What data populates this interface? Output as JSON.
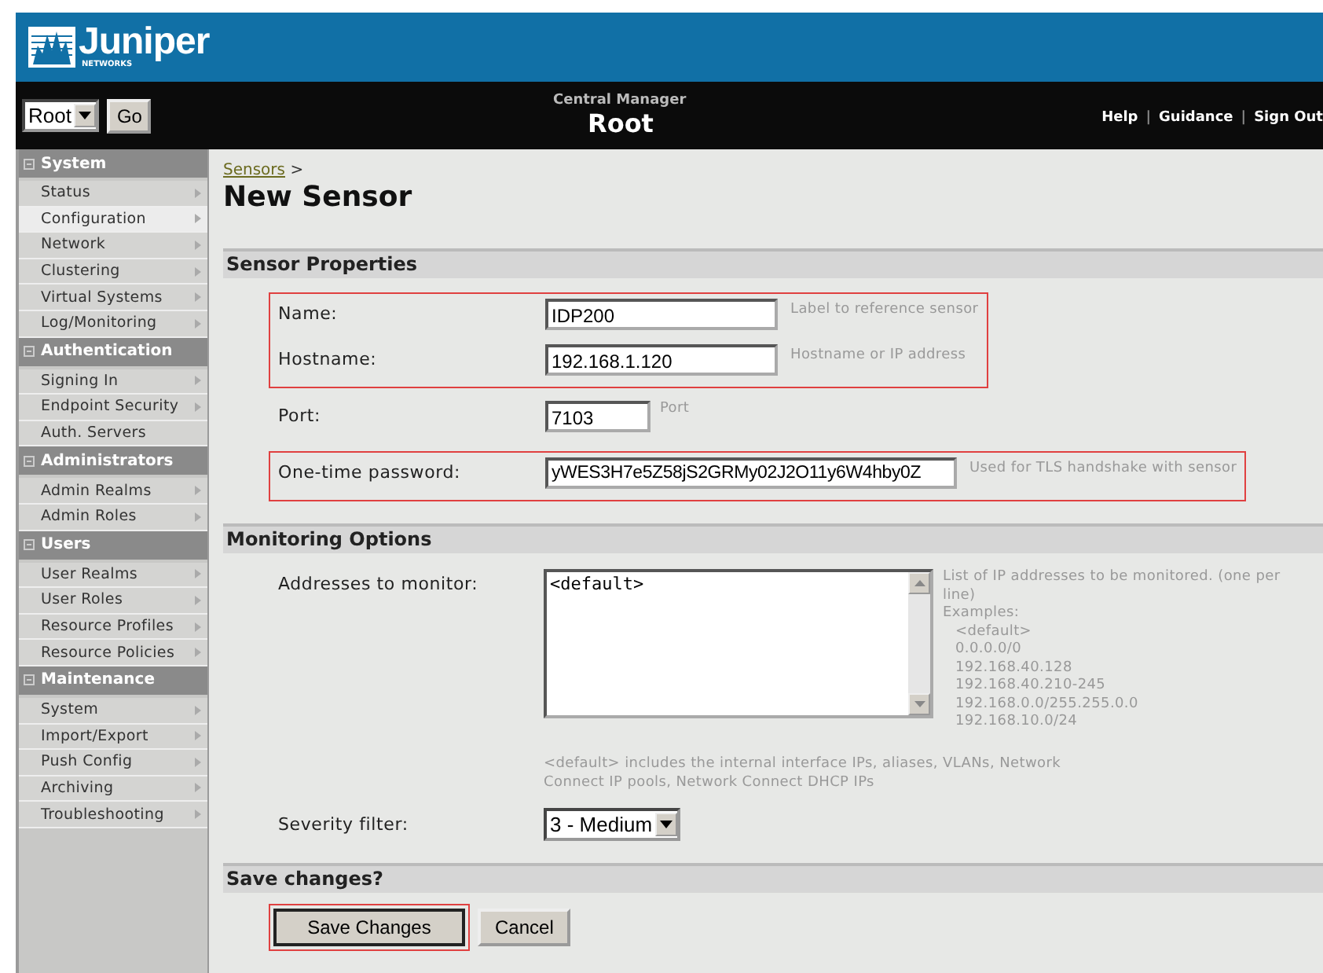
{
  "header": {
    "logo": "Juniper",
    "logo_sub": "NETWORKS",
    "realm_select": "Root",
    "go_button": "Go",
    "app_name": "Central Manager",
    "context": "Root",
    "links": [
      "Help",
      "Guidance",
      "Sign Out"
    ],
    "link_separator": "|"
  },
  "sidebar": {
    "sections": [
      {
        "title": "System",
        "expanded": true,
        "items": [
          {
            "label": "Status",
            "selected": false,
            "submenu": true
          },
          {
            "label": "Configuration",
            "selected": true,
            "submenu": true
          },
          {
            "label": "Network",
            "selected": false,
            "submenu": true
          },
          {
            "label": "Clustering",
            "selected": false,
            "submenu": true
          },
          {
            "label": "Virtual Systems",
            "selected": false,
            "submenu": true
          },
          {
            "label": "Log/Monitoring",
            "selected": false,
            "submenu": true
          }
        ]
      },
      {
        "title": "Authentication",
        "expanded": true,
        "items": [
          {
            "label": "Signing In",
            "selected": false,
            "submenu": true
          },
          {
            "label": "Endpoint Security",
            "selected": false,
            "submenu": true
          },
          {
            "label": "Auth. Servers",
            "selected": false,
            "submenu": false
          }
        ]
      },
      {
        "title": "Administrators",
        "expanded": true,
        "items": [
          {
            "label": "Admin Realms",
            "selected": false,
            "submenu": true
          },
          {
            "label": "Admin Roles",
            "selected": false,
            "submenu": true
          }
        ]
      },
      {
        "title": "Users",
        "expanded": true,
        "items": [
          {
            "label": "User Realms",
            "selected": false,
            "submenu": true
          },
          {
            "label": "User Roles",
            "selected": false,
            "submenu": true
          },
          {
            "label": "Resource Profiles",
            "selected": false,
            "submenu": true
          },
          {
            "label": "Resource Policies",
            "selected": false,
            "submenu": true
          }
        ]
      },
      {
        "title": "Maintenance",
        "expanded": true,
        "items": [
          {
            "label": "System",
            "selected": false,
            "submenu": true
          },
          {
            "label": "Import/Export",
            "selected": false,
            "submenu": true
          },
          {
            "label": "Push Config",
            "selected": false,
            "submenu": true
          },
          {
            "label": "Archiving",
            "selected": false,
            "submenu": true
          },
          {
            "label": "Troubleshooting",
            "selected": false,
            "submenu": true
          }
        ]
      }
    ]
  },
  "breadcrumb": {
    "link": "Sensors",
    "separator": ">"
  },
  "page_title": "New Sensor",
  "sensor_properties": {
    "heading": "Sensor Properties",
    "groups": [
      {
        "highlighted": true,
        "fields": [
          {
            "label": "Name:",
            "value": "IDP200",
            "hint": "Label to reference sensor",
            "kind": "wide"
          },
          {
            "label": "Hostname:",
            "value": "192.168.1.120",
            "hint": "Hostname or IP address",
            "kind": "wide"
          }
        ]
      },
      {
        "highlighted": false,
        "fields": [
          {
            "label": "Port:",
            "value": "7103",
            "hint": "Port",
            "kind": "short"
          }
        ]
      },
      {
        "highlighted": true,
        "fields": [
          {
            "label": "One-time password:",
            "value": "yWES3H7e5Z58jS2GRMy02J2O11y6W4hby0Z",
            "hint": "Used for TLS handshake with sensor",
            "kind": "long"
          }
        ]
      }
    ]
  },
  "monitoring_options": {
    "heading": "Monitoring Options",
    "addresses_label": "Addresses to monitor:",
    "addresses_value": "<default>",
    "addresses_help": "List of IP addresses to be monitored. (one per line)",
    "examples_label": "Examples:",
    "examples": [
      "<default>",
      "0.0.0.0/0",
      "192.168.40.128",
      "192.168.40.210-245",
      "192.168.0.0/255.255.0.0",
      "192.168.10.0/24"
    ],
    "default_note": "<default> includes the internal interface IPs, aliases, VLANs, Network Connect IP pools, Network Connect DHCP IPs",
    "severity_label": "Severity filter:",
    "severity_value": "3 - Medium"
  },
  "save": {
    "heading": "Save changes?",
    "buttons": [
      {
        "label": "Save Changes",
        "highlighted": true
      },
      {
        "label": "Cancel",
        "highlighted": false
      }
    ]
  }
}
